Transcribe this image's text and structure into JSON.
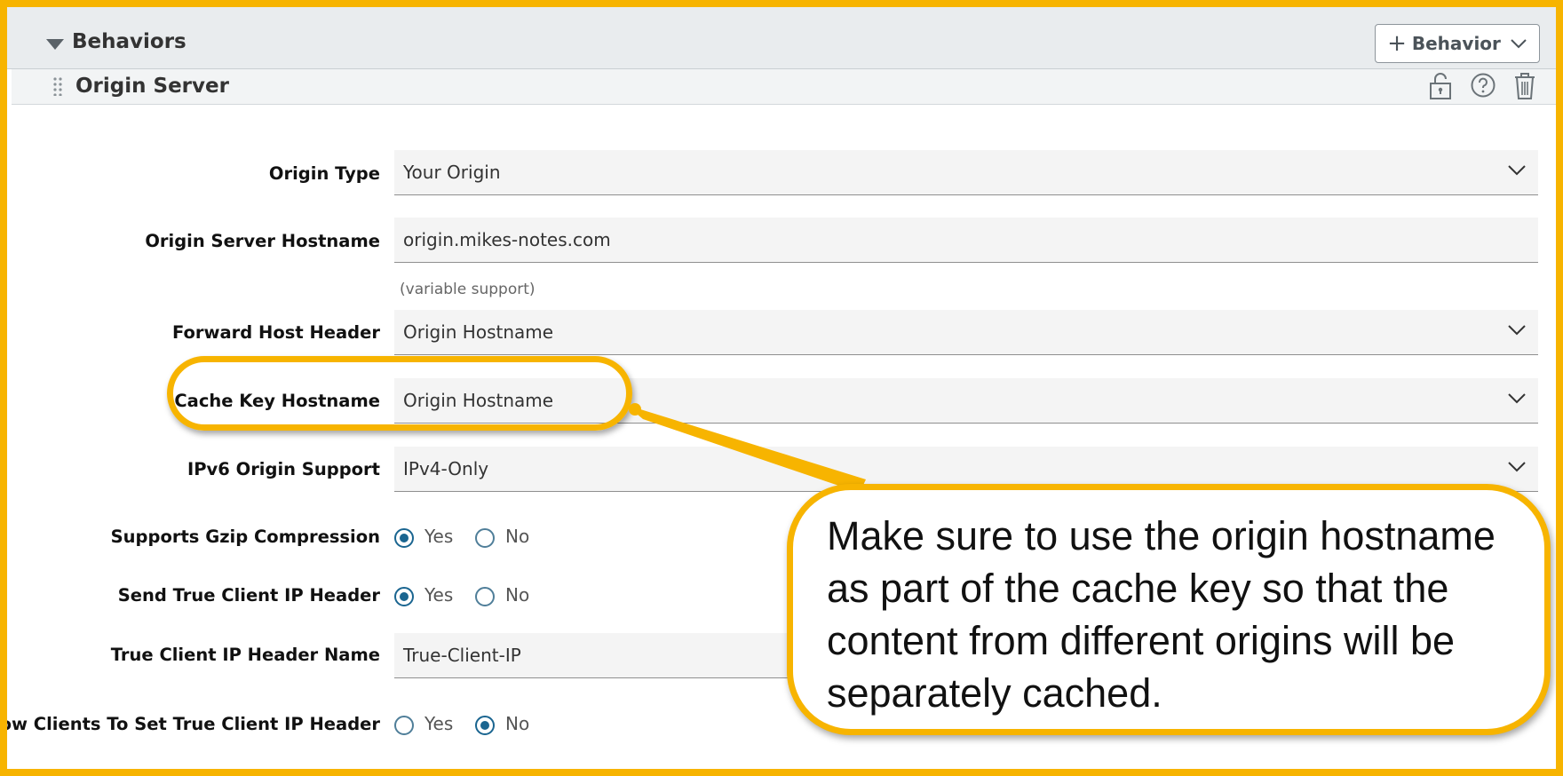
{
  "behaviors": {
    "title": "Behaviors",
    "add_button_label": "Behavior"
  },
  "origin_server": {
    "title": "Origin Server",
    "icons": [
      "unlock-icon",
      "help-icon",
      "trash-icon"
    ]
  },
  "form": {
    "origin_type": {
      "label": "Origin Type",
      "value": "Your Origin"
    },
    "hostname": {
      "label": "Origin Server Hostname",
      "value": "origin.mikes-notes.com",
      "hint": "(variable support)"
    },
    "forward_host_header": {
      "label": "Forward Host Header",
      "value": "Origin Hostname"
    },
    "cache_key_hostname": {
      "label": "Cache Key Hostname",
      "value": "Origin Hostname"
    },
    "ipv6_support": {
      "label": "IPv6 Origin Support",
      "value": "IPv4-Only"
    },
    "gzip": {
      "label": "Supports Gzip Compression",
      "yes": "Yes",
      "no": "No",
      "selected": "Yes"
    },
    "send_true_client_ip": {
      "label": "Send True Client IP Header",
      "yes": "Yes",
      "no": "No",
      "selected": "Yes"
    },
    "true_client_ip_name": {
      "label": "True Client IP Header Name",
      "value": "True-Client-IP"
    },
    "allow_clients_set": {
      "label": "Allow Clients To Set True Client IP Header",
      "yes": "Yes",
      "no": "No",
      "selected": "No"
    }
  },
  "annotation": {
    "text": "Make sure to use the origin hostname as part of the cache key so that the content from different origins will be separately cached.",
    "color": "#f7b400"
  },
  "colors": {
    "radio_selected": "#1a6590",
    "header_bg": "#e9ecee"
  }
}
